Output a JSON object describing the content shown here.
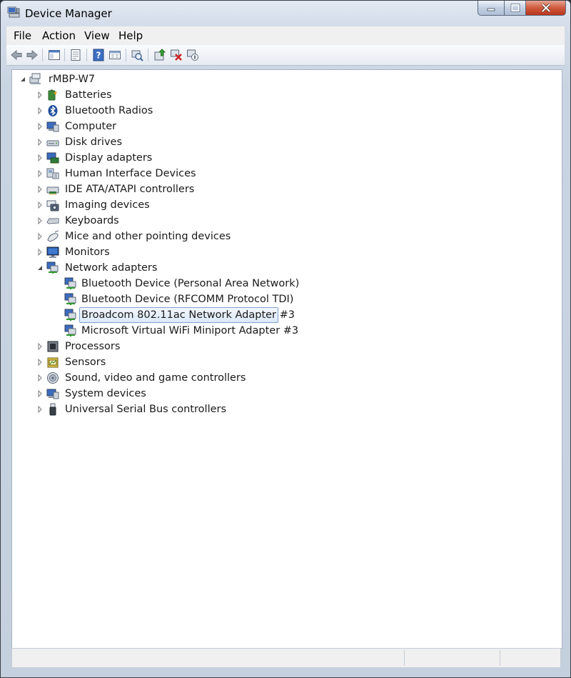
{
  "window": {
    "title": "Device Manager"
  },
  "menu": [
    "File",
    "Action",
    "View",
    "Help"
  ],
  "toolbar": {
    "buttons": [
      "back-icon",
      "forward-icon",
      "show-hide-tree-icon",
      "properties-icon",
      "help-icon",
      "view-icon",
      "scan-hardware-icon",
      "update-driver-icon",
      "uninstall-icon",
      "disable-device-icon"
    ]
  },
  "tree": {
    "root": "rMBP-W7",
    "categories": [
      {
        "label": "Batteries",
        "icon": "battery-icon",
        "expanded": false
      },
      {
        "label": "Bluetooth Radios",
        "icon": "bluetooth-icon",
        "expanded": false
      },
      {
        "label": "Computer",
        "icon": "computer-icon",
        "expanded": false
      },
      {
        "label": "Disk drives",
        "icon": "disk-drive-icon",
        "expanded": false
      },
      {
        "label": "Display adapters",
        "icon": "display-adapter-icon",
        "expanded": false
      },
      {
        "label": "Human Interface Devices",
        "icon": "hid-icon",
        "expanded": false
      },
      {
        "label": "IDE ATA/ATAPI controllers",
        "icon": "ide-controller-icon",
        "expanded": false
      },
      {
        "label": "Imaging devices",
        "icon": "camera-icon",
        "expanded": false
      },
      {
        "label": "Keyboards",
        "icon": "keyboard-icon",
        "expanded": false
      },
      {
        "label": "Mice and other pointing devices",
        "icon": "mouse-icon",
        "expanded": false
      },
      {
        "label": "Monitors",
        "icon": "monitor-icon",
        "expanded": false
      },
      {
        "label": "Network adapters",
        "icon": "network-adapter-icon",
        "expanded": true,
        "children": [
          {
            "label": "Bluetooth Device (Personal Area Network)",
            "selected": false
          },
          {
            "label": "Bluetooth Device (RFCOMM Protocol TDI)",
            "selected": false
          },
          {
            "label": "Broadcom 802.11ac Network Adapter #3",
            "selected": true
          },
          {
            "label": "Microsoft Virtual WiFi Miniport Adapter #3",
            "selected": false
          }
        ]
      },
      {
        "label": "Processors",
        "icon": "processor-icon",
        "expanded": false
      },
      {
        "label": "Sensors",
        "icon": "sensor-icon",
        "expanded": false
      },
      {
        "label": "Sound, video and game controllers",
        "icon": "speaker-icon",
        "expanded": false
      },
      {
        "label": "System devices",
        "icon": "system-devices-icon",
        "expanded": false
      },
      {
        "label": "Universal Serial Bus controllers",
        "icon": "usb-icon",
        "expanded": false
      }
    ]
  },
  "statusbar": {
    "text": ""
  }
}
